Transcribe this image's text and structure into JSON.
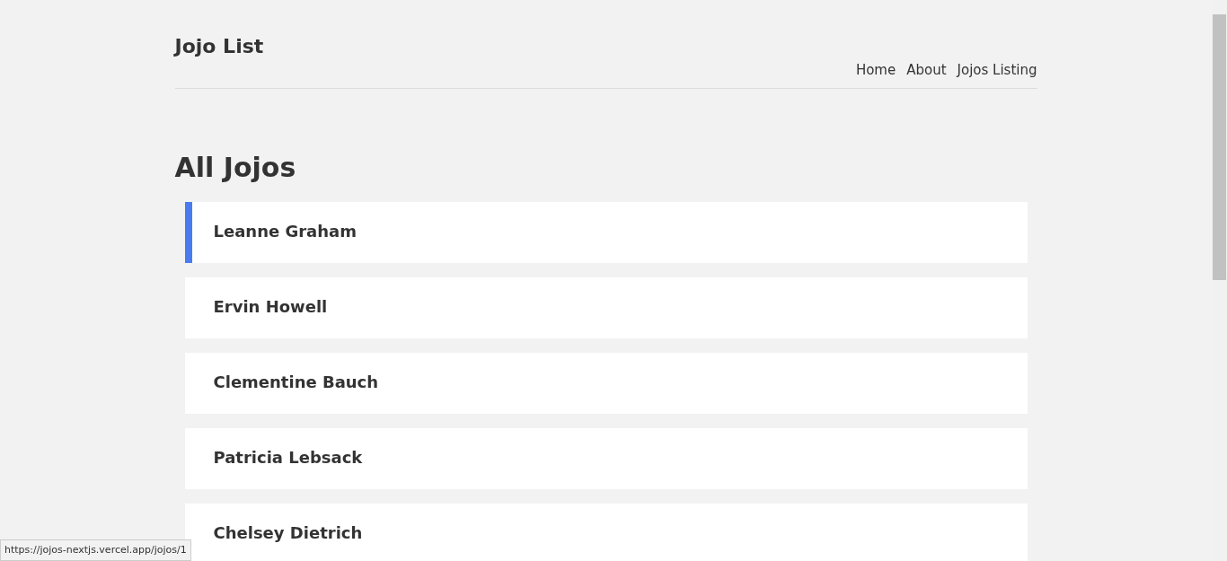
{
  "header": {
    "title": "Jojo List",
    "nav": [
      {
        "label": "Home"
      },
      {
        "label": "About"
      },
      {
        "label": "Jojos Listing"
      }
    ]
  },
  "page_title": "All Jojos",
  "jojos": [
    {
      "name": "Leanne Graham",
      "selected": true
    },
    {
      "name": "Ervin Howell",
      "selected": false
    },
    {
      "name": "Clementine Bauch",
      "selected": false
    },
    {
      "name": "Patricia Lebsack",
      "selected": false
    },
    {
      "name": "Chelsey Dietrich",
      "selected": false
    }
  ],
  "status_bar": {
    "url": "https://jojos-nextjs.vercel.app/jojos/1"
  }
}
